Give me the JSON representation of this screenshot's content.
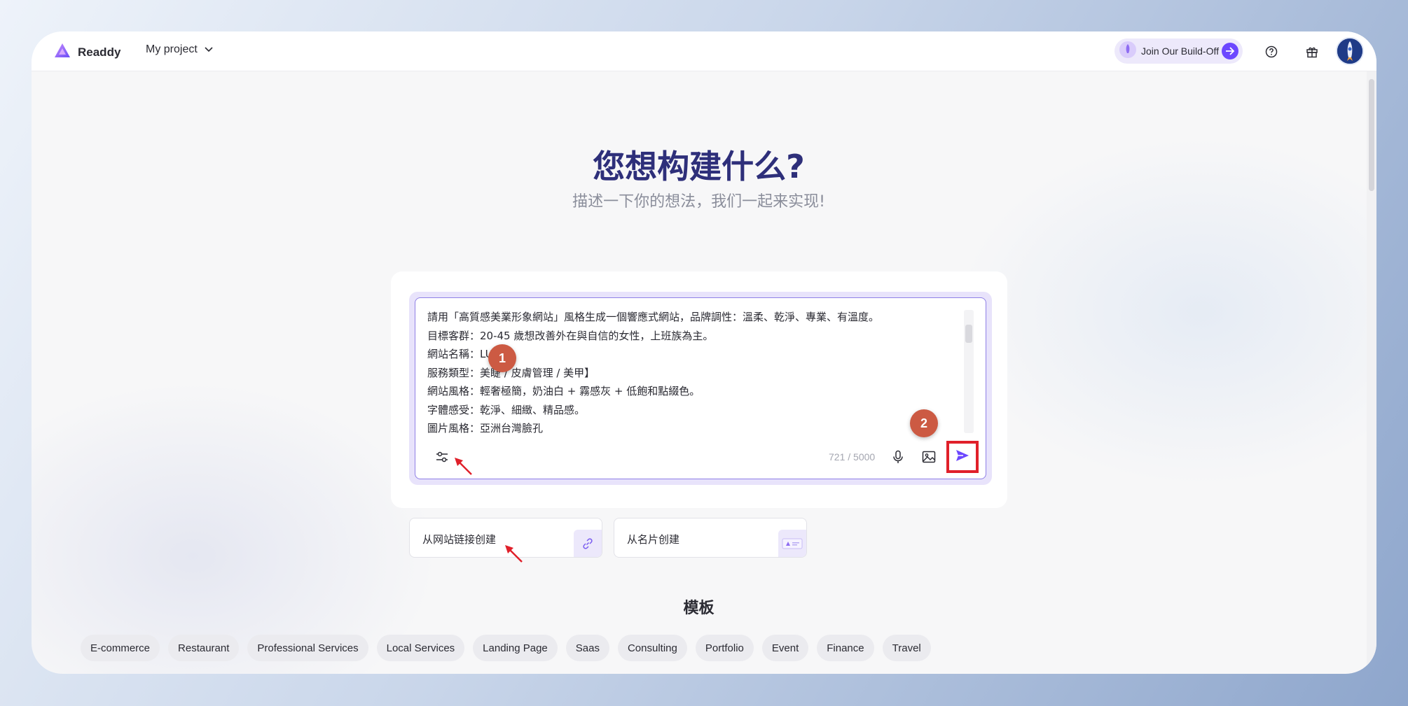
{
  "header": {
    "brand": "Readdy",
    "project_label": "My project",
    "buildoff_label": "Join Our Build-Off"
  },
  "hero": {
    "title": "您想构建什么?",
    "subtitle": "描述一下你的想法，我们一起来实现!"
  },
  "composer": {
    "prompt_lines": [
      "請用「高質感美業形象網站」風格生成一個響應式網站，品牌調性：溫柔、乾淨、專業、有溫度。",
      "目標客群：20-45 歲想改善外在與自信的女性，上班族為主。",
      "網站名稱：LUMIE",
      "服務類型：美睫 / 皮膚管理 / 美甲】",
      "網站風格：輕奢極簡，奶油白 + 霧感灰 + 低飽和點綴色。",
      "字體感受：乾淨、細緻、精品感。",
      "圖片風格：亞洲台灣臉孔"
    ],
    "char_counter": "721 / 5000"
  },
  "annotations": {
    "badge_1": "1",
    "badge_2": "2"
  },
  "options": {
    "from_url": "从网站链接创建",
    "from_card": "从名片创建"
  },
  "templates": {
    "title": "模板",
    "chips": [
      "E-commerce",
      "Restaurant",
      "Professional Services",
      "Local Services",
      "Landing Page",
      "Saas",
      "Consulting",
      "Portfolio",
      "Event",
      "Finance",
      "Travel"
    ]
  },
  "icons": {
    "logo": "readdy-logo-icon",
    "chevron": "chevron-down-icon",
    "help": "help-circle-icon",
    "gift": "gift-icon",
    "settings": "sliders-icon",
    "mic": "microphone-icon",
    "image": "image-icon",
    "send": "send-icon",
    "link": "link-icon"
  },
  "colors": {
    "accent": "#6c47ff",
    "title": "#2e2f7a",
    "highlight_box": "#e0202a",
    "badge": "#cc5a43"
  }
}
